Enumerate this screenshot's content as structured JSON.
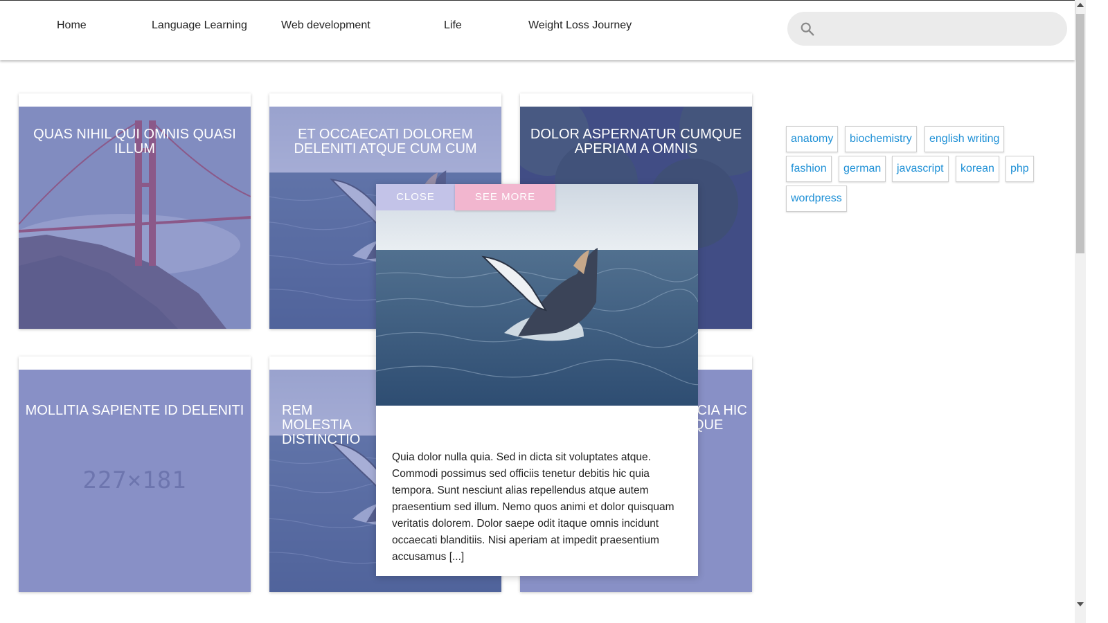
{
  "nav": {
    "items": [
      "Home",
      "Language Learning",
      "Web development",
      "Life",
      "Weight Loss Journey"
    ]
  },
  "search": {
    "placeholder": "",
    "value": "",
    "icon": "search-icon"
  },
  "posts": [
    {
      "title": "QUAS NIHIL QUI OMNIS QUASI ILLUM",
      "image": "golden-gate-bridge"
    },
    {
      "title": "ET OCCAECATI DOLOREM DELENITI ATQUE CUM CUM",
      "image": "whale"
    },
    {
      "title": "DOLOR ASPERNATUR CUMQUE APERIAM A OMNIS",
      "image": "forest-road"
    },
    {
      "title": "MOLLITIA SAPIENTE ID DELENITI",
      "image": "placeholder",
      "placeholder_text": "227×181"
    },
    {
      "title": "REM MOLESTIA DISTINCTIO",
      "image": "whale"
    },
    {
      "title": "ICIA HIC QUE",
      "image": "plain"
    }
  ],
  "tags": [
    "anatomy",
    "biochemistry",
    "english writing",
    "fashion",
    "german",
    "javascript",
    "korean",
    "php",
    "wordpress"
  ],
  "modal": {
    "close_label": "CLOSE",
    "see_more_label": "SEE MORE",
    "image": "whale",
    "excerpt": "Quia dolor nulla quia. Sed in dicta sit voluptates atque. Commodi possimus sed officiis tenetur debitis hic quia tempora. Sunt nesciunt alias repellendus atque autem praesentium sed illum. Nemo quos animi et dolor quisquam veritatis dolorem. Dolor saepe odit itaque omnis incidunt occaecati blanditiis. Nisi aperiam at impedit praesentium accusamus [...]"
  },
  "colors": {
    "tag_link": "#1e90d6",
    "card_tint": "#6e76be",
    "close_button": "#c3c3e8",
    "see_more_button": "#f2b6cf"
  }
}
